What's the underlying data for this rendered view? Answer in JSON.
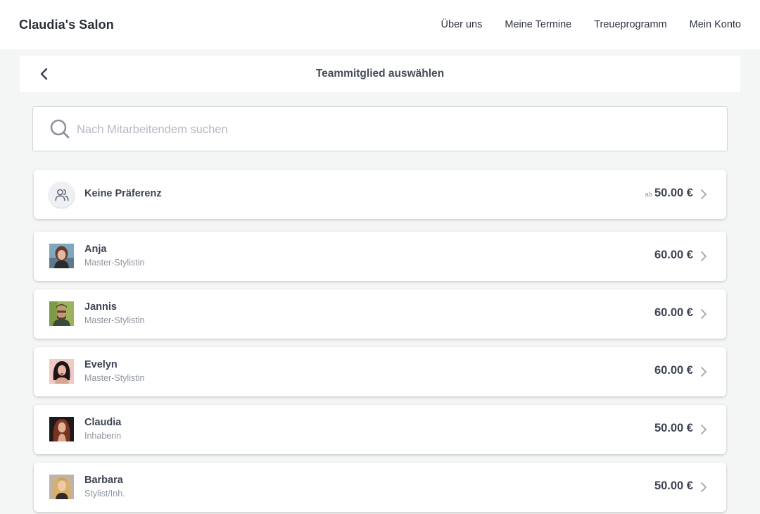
{
  "header": {
    "brand": "Claudia's Salon",
    "nav": [
      "Über uns",
      "Meine Termine",
      "Treueprogramm",
      "Mein Konto"
    ]
  },
  "subheader": {
    "title": "Teammitglied auswählen"
  },
  "search": {
    "placeholder": "Nach Mitarbeitendem suchen",
    "value": ""
  },
  "no_preference": {
    "label": "Keine Präferenz",
    "from_label": "ab",
    "price": "50.00 €"
  },
  "staff": [
    {
      "name": "Anja",
      "role": "Master-Stylistin",
      "price": "60.00 €"
    },
    {
      "name": "Jannis",
      "role": "Master-Stylistin",
      "price": "60.00 €"
    },
    {
      "name": "Evelyn",
      "role": "Master-Stylistin",
      "price": "60.00 €"
    },
    {
      "name": "Claudia",
      "role": "Inhaberin",
      "price": "50.00 €"
    },
    {
      "name": "Barbara",
      "role": "Stylist/Inh.",
      "price": "50.00 €"
    }
  ],
  "icons": {
    "back": "chevron-left-icon",
    "search": "search-icon",
    "group": "users-icon",
    "row_chevron": "chevron-right-icon"
  },
  "colors": {
    "text": "#3d4452",
    "muted": "#8e949d",
    "background": "#f4f5f5"
  }
}
